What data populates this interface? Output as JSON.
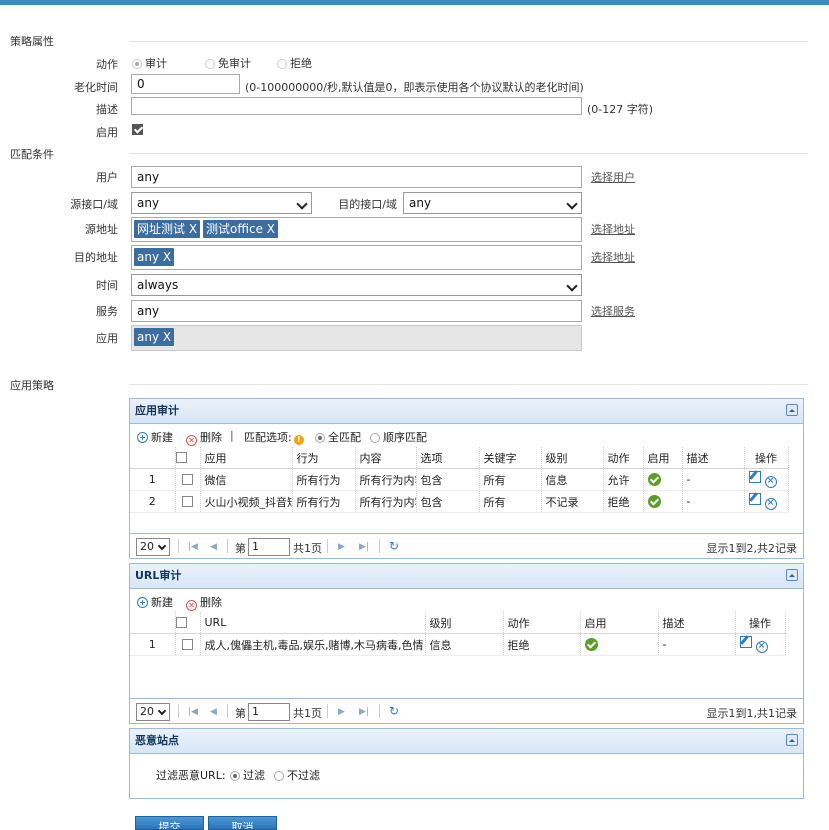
{
  "sections": {
    "policy_attrs": "策略属性",
    "match_conditions": "匹配条件",
    "app_policy": "应用策略"
  },
  "policy": {
    "action_label": "动作",
    "action_options": [
      "审计",
      "免审计",
      "拒绝"
    ],
    "aging_label": "老化时间",
    "aging_value": "0",
    "aging_hint": "(0-100000000/秒,默认值是0，即表示使用各个协议默认的老化时间)",
    "desc_label": "描述",
    "desc_value": "",
    "desc_hint": "(0-127 字符)",
    "enable_label": "启用"
  },
  "match": {
    "user_label": "用户",
    "user_value": "any",
    "select_user": "选择用户",
    "src_if_label": "源接口/域",
    "src_if_value": "any",
    "dst_if_label": "目的接口/域",
    "dst_if_value": "any",
    "src_addr_label": "源地址",
    "src_addr_tags": [
      "网址测试 X",
      "测试office X"
    ],
    "select_addr_1": "选择地址",
    "dst_addr_label": "目的地址",
    "dst_addr_tags": [
      "any X"
    ],
    "select_addr_2": "选择地址",
    "time_label": "时间",
    "time_value": "always",
    "service_label": "服务",
    "service_value": "any",
    "select_service": "选择服务",
    "app_label": "应用",
    "app_tags": [
      "any X"
    ]
  },
  "app_audit": {
    "title": "应用审计",
    "add": "新建",
    "delete": "删除",
    "divider": "|",
    "match_option_label": "匹配选项:",
    "warn_glyph": "!",
    "match_all": "全匹配",
    "match_order": "顺序匹配",
    "columns": [
      "应用",
      "行为",
      "内容",
      "选项",
      "关键字",
      "级别",
      "动作",
      "启用",
      "描述",
      "操作"
    ],
    "rows": [
      {
        "no": "1",
        "app": "微信",
        "behavior": "所有行为",
        "content": "所有行为内容",
        "option": "包含",
        "keyword": "所有",
        "level": "信息",
        "action": "允许",
        "desc": "-"
      },
      {
        "no": "2",
        "app": "火山小视频_抖音短视频",
        "behavior": "所有行为",
        "content": "所有行为内容",
        "option": "包含",
        "keyword": "所有",
        "level": "不记录",
        "action": "拒绝",
        "desc": "-"
      }
    ],
    "pager": {
      "size": "20",
      "page_prefix": "第",
      "page": "1",
      "page_total": "共1页",
      "summary": "显示1到2,共2记录"
    }
  },
  "url_audit": {
    "title": "URL审计",
    "add": "新建",
    "delete": "删除",
    "columns": [
      "URL",
      "级别",
      "动作",
      "启用",
      "描述",
      "操作"
    ],
    "rows": [
      {
        "no": "1",
        "url": "成人,傀儡主机,毒品,娱乐,赌博,木马病毒,色情",
        "level": "信息",
        "action": "拒绝",
        "desc": "-"
      }
    ],
    "pager": {
      "size": "20",
      "page_prefix": "第",
      "page": "1",
      "page_total": "共1页",
      "summary": "显示1到1,共1记录"
    }
  },
  "malicious": {
    "title": "恶意站点",
    "filter_label": "过滤恶意URL:",
    "filter_on": "过滤",
    "filter_off": "不过滤"
  },
  "buttons": {
    "submit": "提交",
    "cancel": "取消"
  },
  "colors": {
    "accent": "#3c8dbc",
    "tag": "#3c6d9e",
    "ok": "#5a9d27",
    "panel_border": "#9cb9d6"
  }
}
